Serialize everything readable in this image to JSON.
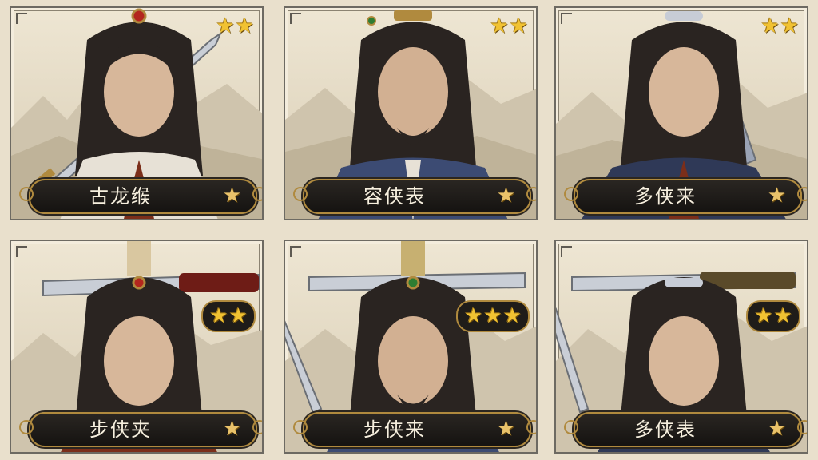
{
  "cards": [
    {
      "name": "古龙缑",
      "stars": 2,
      "rank_star": "★",
      "accent": "#b3261e"
    },
    {
      "name": "容侠表",
      "stars": 2,
      "rank_star": "★",
      "accent": "#2e7d32"
    },
    {
      "name": "多侠来",
      "stars": 2,
      "rank_star": "★",
      "accent": "#9aa3b5"
    },
    {
      "name": "步侠夹",
      "stars": 2,
      "rank_star": "★",
      "accent": "#b3261e"
    },
    {
      "name": "步侠来",
      "stars": 3,
      "rank_star": "★",
      "accent": "#2e7d32"
    },
    {
      "name": "多侠表",
      "stars": 2,
      "rank_star": "★",
      "accent": "#9aa3b5"
    }
  ],
  "colors": {
    "frame": "#b08a3e",
    "plaque": "#1f1c19",
    "star": "#f1c232",
    "parchment": "#e9e0cc"
  },
  "icons": {
    "star": "star-icon",
    "hero": "hero-portrait",
    "sword": "sword-icon",
    "mountains": "mountain-landscape"
  }
}
